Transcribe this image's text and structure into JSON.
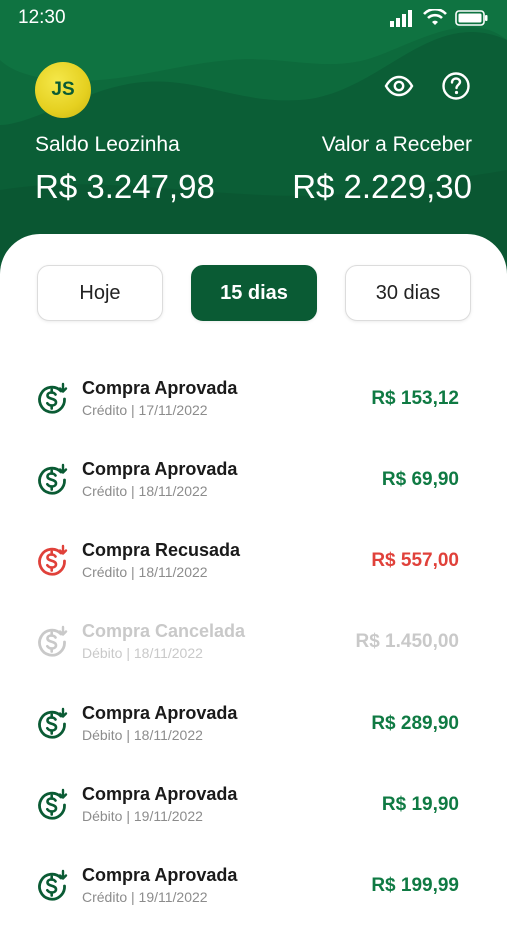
{
  "status_bar": {
    "time": "12:30"
  },
  "header": {
    "avatar_initials": "JS",
    "left": {
      "label": "Saldo Leozinha",
      "value": "R$ 3.247,98"
    },
    "right": {
      "label": "Valor a Receber",
      "value": "R$ 2.229,30"
    },
    "icons": [
      "eye-icon",
      "help-icon"
    ]
  },
  "filters": {
    "today": "Hoje",
    "fifteen": "15 dias",
    "thirty": "30 dias",
    "selected": "15 dias"
  },
  "transactions": [
    {
      "title": "Compra Aprovada",
      "sub": "Crédito | 17/11/2022",
      "amount": "R$ 153,12",
      "status": "approved"
    },
    {
      "title": "Compra Aprovada",
      "sub": "Crédito | 18/11/2022",
      "amount": "R$ 69,90",
      "status": "approved"
    },
    {
      "title": "Compra Recusada",
      "sub": "Crédito | 18/11/2022",
      "amount": "R$ 557,00",
      "status": "refused"
    },
    {
      "title": "Compra Cancelada",
      "sub": "Débito | 18/11/2022",
      "amount": "R$ 1.450,00",
      "status": "canceled"
    },
    {
      "title": "Compra Aprovada",
      "sub": "Débito | 18/11/2022",
      "amount": "R$ 289,90",
      "status": "approved"
    },
    {
      "title": "Compra Aprovada",
      "sub": "Débito | 19/11/2022",
      "amount": "R$ 19,90",
      "status": "approved"
    },
    {
      "title": "Compra Aprovada",
      "sub": "Crédito | 19/11/2022",
      "amount": "R$ 199,99",
      "status": "approved"
    }
  ],
  "colors": {
    "brand_green": "#0a5b34",
    "approved": "#0f7a43",
    "refused": "#e0413a",
    "canceled": "#c9c9c9",
    "avatar_yellow": "#e5d020"
  }
}
